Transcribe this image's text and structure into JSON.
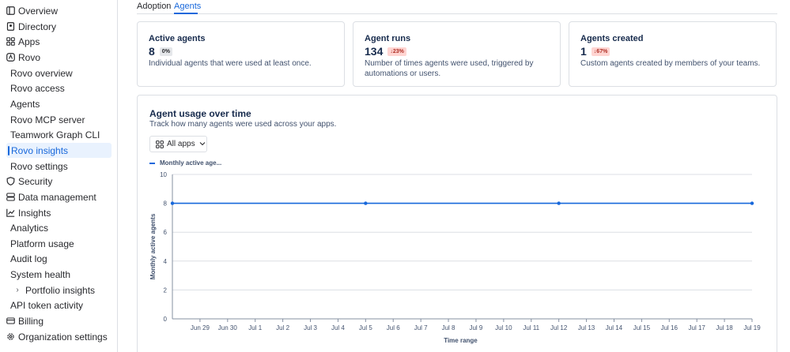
{
  "sidebar": {
    "items": [
      {
        "label": "Overview",
        "icon": "overview-icon"
      },
      {
        "label": "Directory",
        "icon": "directory-icon"
      },
      {
        "label": "Apps",
        "icon": "apps-icon"
      },
      {
        "label": "Rovo",
        "icon": "rovo-icon"
      },
      {
        "label": "Rovo overview"
      },
      {
        "label": "Rovo access"
      },
      {
        "label": "Agents"
      },
      {
        "label": "Rovo MCP server"
      },
      {
        "label": "Teamwork Graph CLI"
      },
      {
        "label": "Rovo insights",
        "active": true
      },
      {
        "label": "Rovo settings"
      },
      {
        "label": "Security",
        "icon": "shield-icon"
      },
      {
        "label": "Data management",
        "icon": "database-icon"
      },
      {
        "label": "Insights",
        "icon": "insights-icon"
      },
      {
        "label": "Analytics"
      },
      {
        "label": "Platform usage"
      },
      {
        "label": "Audit log"
      },
      {
        "label": "System health"
      },
      {
        "label": "Portfolio insights"
      },
      {
        "label": "API token activity"
      },
      {
        "label": "Billing",
        "icon": "billing-icon"
      },
      {
        "label": "Organization settings",
        "icon": "gear-icon"
      }
    ]
  },
  "tabs": [
    {
      "label": "Adoption"
    },
    {
      "label": "Agents",
      "active": true
    }
  ],
  "cards": [
    {
      "title": "Active agents",
      "value": "8",
      "badge": "0%",
      "description": "Individual agents that were used at least once."
    },
    {
      "title": "Agent runs",
      "value": "134",
      "badge": "↓23%",
      "description": "Number of times agents were used, triggered by automations or users."
    },
    {
      "title": "Agents created",
      "value": "1",
      "badge": "↓67%",
      "description": "Custom agents created by members of your teams."
    }
  ],
  "usage": {
    "title": "Agent usage over time",
    "subtitle": "Track how many agents were used across your apps.",
    "filter_label": "All apps",
    "legend_label": "Monthly active age..."
  },
  "chart_data": {
    "type": "line",
    "xlabel": "Time range",
    "ylabel": "Monthly active agents",
    "ylim": [
      0,
      10
    ],
    "yticks": [
      0,
      2,
      4,
      6,
      8,
      10
    ],
    "categories": [
      "Jun 29",
      "Jun 30",
      "Jul 1",
      "Jul 2",
      "Jul 3",
      "Jul 4",
      "Jul 5",
      "Jul 6",
      "Jul 7",
      "Jul 8",
      "Jul 9",
      "Jul 10",
      "Jul 11",
      "Jul 12",
      "Jul 13",
      "Jul 14",
      "Jul 15",
      "Jul 16",
      "Jul 17",
      "Jul 18",
      "Jul 19"
    ],
    "series": [
      {
        "name": "Monthly active age...",
        "color": "#1868db",
        "points": [
          {
            "x": "Jun 28",
            "y": 8
          },
          {
            "x": "Jul 5",
            "y": 8
          },
          {
            "x": "Jul 12",
            "y": 8
          },
          {
            "x": "Jul 19",
            "y": 8
          }
        ]
      }
    ],
    "grid": true,
    "legend": "top-left"
  }
}
